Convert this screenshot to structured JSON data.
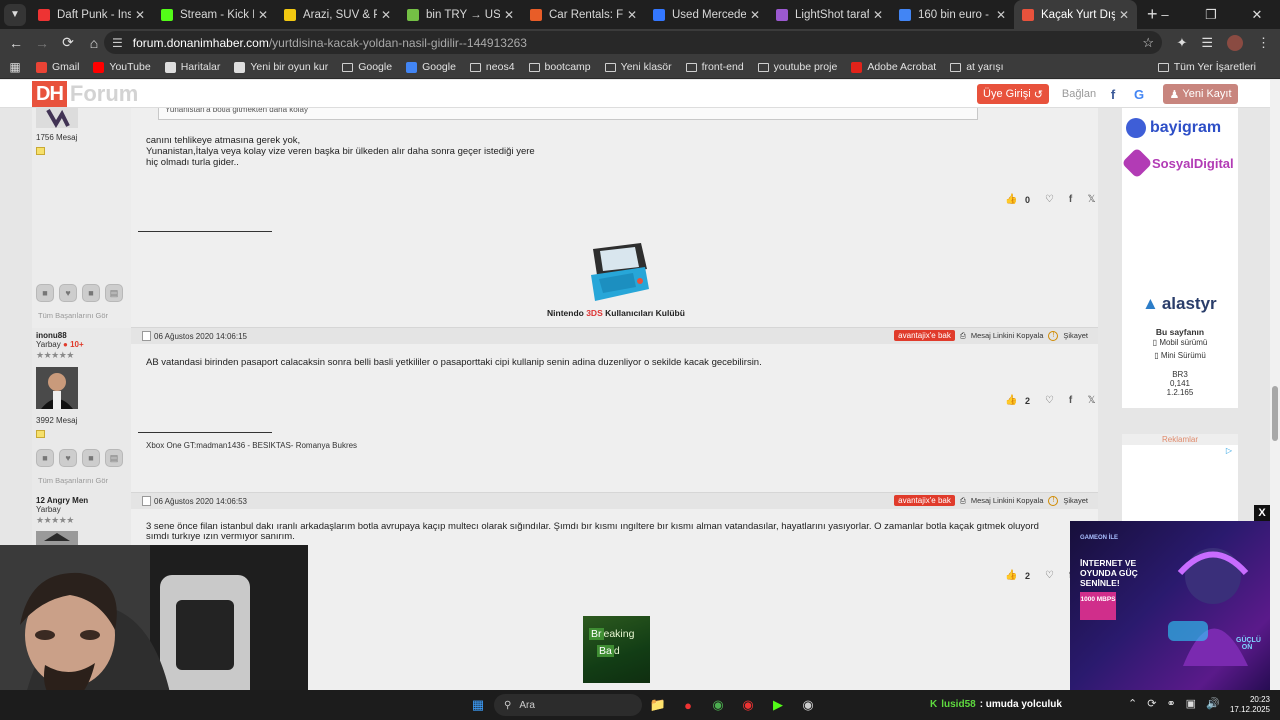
{
  "browser": {
    "tabs": [
      {
        "title": "Daft Punk - Instant",
        "fav_color": "#e33"
      },
      {
        "title": "Stream - Kick Dashbo",
        "fav_color": "#53fc18"
      },
      {
        "title": "Arazi, SUV & Pickup M",
        "fav_color": "#f2c811"
      },
      {
        "title": "bin TRY → USD - Türk",
        "fav_color": "#74c045"
      },
      {
        "title": "Car Rentals: Find Che",
        "fav_color": "#e85d28"
      },
      {
        "title": "Used Mercedes-Benz",
        "fav_color": "#3377ff"
      },
      {
        "title": "LightShot tarafından",
        "fav_color": "#9b59d0"
      },
      {
        "title": "160 bin euro - Google",
        "fav_color": "#4285f4"
      },
      {
        "title": "Kaçak Yurt Dışına Na",
        "fav_color": "#e8523c"
      }
    ],
    "url_host": "forum.donanimhaber.com",
    "url_path": "/yurtdisina-kacak-yoldan-nasil-gidilir--144913263",
    "bookmarks": [
      {
        "label": "Gmail",
        "icon": "gmail-icon"
      },
      {
        "label": "YouTube",
        "icon": "youtube-icon"
      },
      {
        "label": "Haritalar",
        "icon": "maps-icon"
      },
      {
        "label": "Yeni bir oyun kur",
        "icon": "game-icon"
      },
      {
        "label": "Google",
        "icon": "folder-icon"
      },
      {
        "label": "Google",
        "icon": "google-icon"
      },
      {
        "label": "neos4",
        "icon": "folder-icon"
      },
      {
        "label": "bootcamp",
        "icon": "folder-icon"
      },
      {
        "label": "Yeni klasör",
        "icon": "folder-icon"
      },
      {
        "label": "front-end",
        "icon": "folder-icon"
      },
      {
        "label": "youtube proje",
        "icon": "folder-icon"
      },
      {
        "label": "Adobe Acrobat",
        "icon": "acrobat-icon"
      },
      {
        "label": "at yarışı",
        "icon": "folder-icon"
      }
    ],
    "all_bookmarks": "Tüm Yer İşaretleri"
  },
  "site": {
    "logo_dh": "DH",
    "logo_forum": "Forum",
    "login": "Üye Girişi",
    "connect": "Bağlan",
    "register": "Yeni Kayıt"
  },
  "post0": {
    "quote": "Yunanistan'a botla gitmekten daha kolay",
    "msgs": "1756 Mesaj",
    "text": [
      "canını tehlikeye atmasına gerek yok,",
      "Yunanistan,İtalya veya kolay vize veren başka bir ülkeden alır daha sonra geçer istediği yere",
      "hiç olmadı turla gider.."
    ],
    "likes": "0",
    "sig_caption_pre": "Nintendo ",
    "sig_caption_red": "3DS",
    "sig_caption_post": " Kullanıcıları Kulübü",
    "badges_link": "Tüm Başarılarını Gör"
  },
  "post1": {
    "user": "inonu88",
    "rank": "Yarbay",
    "rank_plus": "10+",
    "stars": "★★★★★",
    "date": "06 Ağustos 2020 14:06:15",
    "bak": "avantajix'e bak",
    "copy": "Mesaj Linkini Kopyala",
    "report": "Şikayet",
    "text": "AB vatandasi birinden pasaport calacaksin sonra belli basli yetkililer o pasaporttaki cipi kullanip senin adina duzenliyor o sekilde kacak gecebilirsin.",
    "likes": "2",
    "msgs": "3992 Mesaj",
    "signature": "Xbox One GT:madman1436 - BESIKTAS- Romanya Bukres",
    "badges_link": "Tüm Başarılarını Gör"
  },
  "post2": {
    "user": "12 Angry Men",
    "rank": "Yarbay",
    "stars": "★★★★★",
    "date": "06 Ağustos 2020 14:06:53",
    "bak": "avantajix'e bak",
    "copy": "Mesaj Linkini Kopyala",
    "report": "Şikayet",
    "text1": "3 sene önce filan istanbul dakı ıranlı arkadaşlarım botla avrupaya kaçıp multecı olarak sığındılar. Şımdı bır kısmı ıngıltere bır kısmı alman vatandasılar, hayatlarını yasıyorlar. O zamanlar botla kaçak gıtmek oluyord",
    "text2": "sımdı turkıye ızın vermıyor sanırım.",
    "likes": "2",
    "bb_line1a": "Br",
    "bb_line1b": "eaking",
    "bb_line2a": "Ba",
    "bb_line2b": "d"
  },
  "sidebar": {
    "bayigram": "bayigram",
    "sosyal": "SosyalDigital",
    "alastyr": "alastyr",
    "page_title": "Bu sayfanın",
    "mobile": "Mobil sürümü",
    "mini": "Mini Sürümü",
    "server": "BR3",
    "time": "0,141",
    "version": "1.2.165",
    "ads_label": "Reklamlar"
  },
  "ad": {
    "brand": "GAMEON İLE",
    "headline": "İNTERNET VE OYUNDA GÜÇ SENİNLE!",
    "speed": "1000 MBPS",
    "logo": "GÜÇLÜ ON"
  },
  "taskbar": {
    "search": "Ara",
    "stream_user": "lusid58",
    "stream_title": ": umuda yolculuk",
    "time": "20:23",
    "date": "17.12.2025"
  }
}
